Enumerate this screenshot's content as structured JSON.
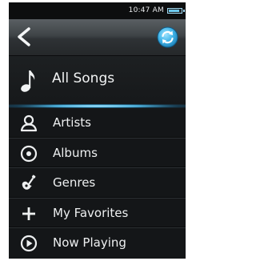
{
  "status_bar": {
    "time": "10:47 AM",
    "battery_level": 0.85,
    "battery_icon": "battery-icon"
  },
  "header": {
    "back_icon": "back-chevron-icon",
    "sync_icon": "sync-icon"
  },
  "all_songs": {
    "label": "All Songs",
    "icon": "music-note-icon"
  },
  "menu": {
    "items": [
      {
        "label": "Artists",
        "icon": "person-icon"
      },
      {
        "label": "Albums",
        "icon": "disc-icon"
      },
      {
        "label": "Genres",
        "icon": "guitar-icon"
      },
      {
        "label": "My Favorites",
        "icon": "plus-icon"
      },
      {
        "label": "Now Playing",
        "icon": "play-circle-icon"
      }
    ]
  },
  "colors": {
    "accent": "#4fb8e6",
    "background": "#141618",
    "text": "#eef0f1"
  }
}
